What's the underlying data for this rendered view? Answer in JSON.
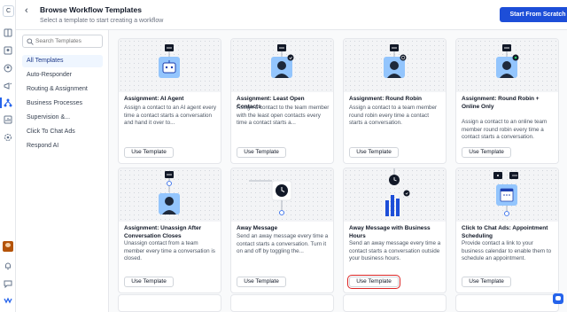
{
  "rail": {
    "workspace_initial": "C"
  },
  "header": {
    "title": "Browse Workflow Templates",
    "subtitle": "Select a template to start creating a workflow",
    "primary_button": "Start From Scratch"
  },
  "sidebar": {
    "search_placeholder": "Search Templates",
    "categories": [
      {
        "label": "All Templates",
        "active": true
      },
      {
        "label": "Auto-Responder"
      },
      {
        "label": "Routing & Assignment"
      },
      {
        "label": "Business Processes"
      },
      {
        "label": "Supervision &..."
      },
      {
        "label": "Click To Chat Ads"
      },
      {
        "label": "Respond AI"
      }
    ]
  },
  "templates": [
    {
      "title": "Assignment: AI Agent",
      "description": "Assign a contact to an AI agent every time a contact starts a conversation and hand it over to...",
      "button": "Use Template"
    },
    {
      "title": "Assignment: Least Open Contacts",
      "description": "Assign a contact to the team member with the least open contacts every time a contact starts a...",
      "button": "Use Template"
    },
    {
      "title": "Assignment: Round Robin",
      "description": "Assign a contact to a team member round robin every time a contact starts a conversation.",
      "button": "Use Template"
    },
    {
      "title": "Assignment: Round Robin + Online Only",
      "description": "Assign a contact to an online team member round robin every time a contact starts a conversation.",
      "button": "Use Template"
    },
    {
      "title": "Assignment: Unassign After Conversation Closes",
      "description": "Unassign contact from a team member every time a conversation is closed.",
      "button": "Use Template"
    },
    {
      "title": "Away Message",
      "description": "Send an away message every time a contact starts a conversation. Turn it on and off by toggling the...",
      "button": "Use Template"
    },
    {
      "title": "Away Message with Business Hours",
      "description": "Send an away message every time a contact starts a conversation outside your business hours.",
      "button": "Use Template",
      "focused": true
    },
    {
      "title": "Click to Chat Ads: Appointment Scheduling",
      "description": "Provide contact a link to your business calendar to enable them to schedule an appointment.",
      "button": "Use Template"
    }
  ],
  "colors": {
    "accent": "#1d4ed8",
    "focus_outline": "#dc2626",
    "icon_blue": "#2563eb"
  }
}
